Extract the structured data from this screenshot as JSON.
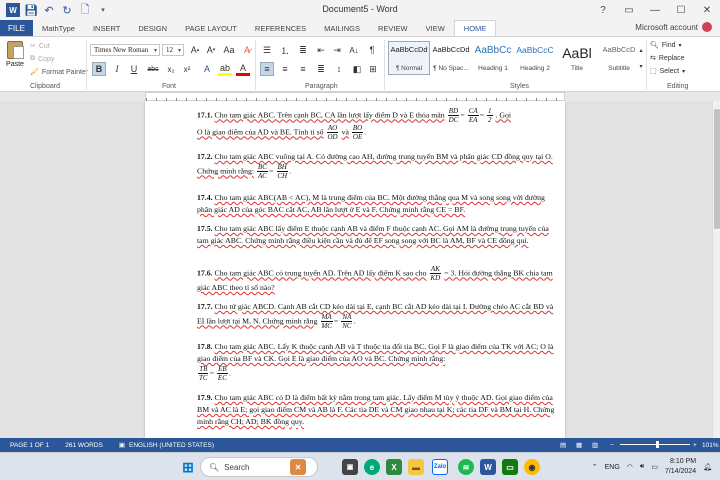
{
  "window": {
    "title": "Document5 - Word",
    "help": "?",
    "account": "Microsoft account"
  },
  "tabs": [
    "FILE",
    "MathType",
    "INSERT",
    "DESIGN",
    "PAGE LAYOUT",
    "REFERENCES",
    "MAILINGS",
    "REVIEW",
    "VIEW",
    "HOME"
  ],
  "clipboard": {
    "paste": "Paste",
    "cut": "Cut",
    "copy": "Copy",
    "format_painter": "Format Painter",
    "label": "Clipboard"
  },
  "font": {
    "name": "Times New Roman",
    "size": "12",
    "label": "Font"
  },
  "paragraph_label": "Paragraph",
  "styles": {
    "label": "Styles",
    "items": [
      {
        "sample": "AaBbCcDd",
        "name": "¶ Normal"
      },
      {
        "sample": "AaBbCcDd",
        "name": "¶ No Spac..."
      },
      {
        "sample": "AaBbCc",
        "name": "Heading 1"
      },
      {
        "sample": "AaBbCcC",
        "name": "Heading 2"
      },
      {
        "sample": "AaBl",
        "name": "Title"
      },
      {
        "sample": "AaBbCcD",
        "name": "Subtitle"
      }
    ]
  },
  "editing": {
    "find": "Find",
    "replace": "Replace",
    "select": "Select",
    "label": "Editing"
  },
  "document": {
    "p1a": "17.1.",
    "p1b": "Cho tam giác ABC. Trên cạnh BC, CA lần lượt lấy điểm D và E thỏa mãn",
    "p1_f1t": "BD",
    "p1_f1b": "DC",
    "p1_f2t": "CA",
    "p1_f2b": "EA",
    "p1_f3t": "1",
    "p1_f3b": "2",
    "p1c": ". Gọi",
    "p1d": "O là giao điểm của AD và BE. Tính tỉ số",
    "p1_f4t": "AO",
    "p1_f4b": "OD",
    "p1_and": "và",
    "p1_f5t": "BO",
    "p1_f5b": "OE",
    "p2a": "17.2.",
    "p2b": "Cho tam giác ABC vuông tại A. Có đường cao AH, đường trung tuyến BM và phân giác CD đồng quy tại O. Chứng minh rằng:",
    "p2_f1t": "BC",
    "p2_f1b": "AC",
    "p2_f2t": "BH",
    "p2_f2b": "CH",
    "p4a": "17.4.",
    "p4b": "Cho tam giác ABC(AB < AC), M là trung điểm của BC. Một đường thẳng qua M và song song với đường phân giác AD của góc BAC cắt AC, AB lần lượt ở E và F. Chứng minh rằng CE = BF.",
    "p5a": "17.5.",
    "p5b": "Cho tam giác ABC lấy điểm E thuộc cạnh AB và điểm F thuộc cạnh AC. Gọi AM là đường trung tuyến của tam giác ABC. Chứng minh rằng điều kiện cần và đủ để EF song song với BC là AM, BF và CE đồng qui.",
    "p6a": "17.6.",
    "p6b": "Cho tam giác ABC có trung tuyến AD. Trên AD lấy điểm K sao cho",
    "p6_ft": "AK",
    "p6_fb": "KD",
    "p6c": "= 3. Hỏi đường thẳng BK chia tam giác ABC theo tỉ số nào?",
    "p7a": "17.7.",
    "p7b": "Cho tứ giác ABCD. Cạnh AB cắt CD kéo dài tại E, cạnh BC cắt AD kéo dài tại I. Đường chéo AC cắt BD và EI lần lượt tại M, N. Chứng minh rằng",
    "p7_f1t": "MA",
    "p7_f1b": "MC",
    "p7_f2t": "NA",
    "p7_f2b": "NC",
    "p8a": "17.8.",
    "p8b": "Cho tam giác ABC. Lấy K thuộc cạnh AB và T thuộc tia đối tia BC. Gọi F là giao điểm của TK với AC; O là giao điểm của BF và CK. Gọi E là giao điểm của AO và BC. Chứng minh rằng:",
    "p8_f1t": "TB",
    "p8_f1b": "TC",
    "p8_f2t": "EB",
    "p8_f2b": "EC",
    "p9a": "17.9.",
    "p9b": "Cho tam giác ABC có D là điểm bất kỳ nằm trong tam giác. Lấy điểm M tùy ý thuộc AD. Gọi giao điểm của BM và AC là E; gọi giao điểm CM và AB là F. Các tia DE và CM giao nhau tại K; các tia DF và BM tại H. Chứng minh rằng CH; AD; BK đồng quy."
  },
  "status": {
    "page": "PAGE 1 OF 1",
    "words": "261 WORDS",
    "language": "ENGLISH (UNITED STATES)",
    "zoom": "101%"
  },
  "taskbar": {
    "search": "Search",
    "lang": "ENG",
    "time": "8:10 PM",
    "date": "7/14/2024"
  }
}
